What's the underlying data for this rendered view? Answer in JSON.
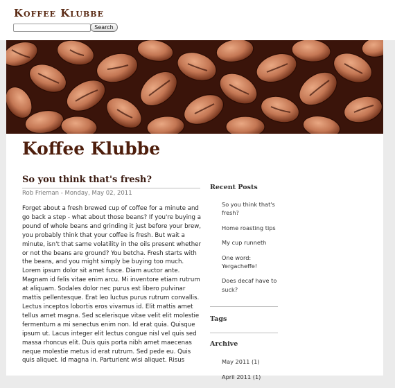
{
  "site": {
    "name": "Koffee Klubbe",
    "search_button": "Search",
    "search_value": ""
  },
  "blog": {
    "title": "Koffee Klubbe"
  },
  "post": {
    "title": "So you think that's fresh?",
    "meta": "Rob Frieman - Monday, May 02, 2011",
    "body": "Forget about a fresh brewed cup of coffee for a minute and go back a step - what about those beans? If you're buying a pound of whole beans and grinding it just before your brew, you probably think that your coffee is fresh. But wait a minute, isn't that same volatility in the oils present whether or not the beans are ground? You betcha. Fresh starts with the beans, and you might simply be buying too much. Lorem ipsum dolor sit amet fusce. Diam auctor ante. Magnam id felis vitae enim arcu. Mi inventore etiam rutrum at aliquam. Sodales dolor nec purus est libero pulvinar mattis pellentesque. Erat leo luctus purus rutrum convallis. Lectus inceptos lobortis eros vivamus id. Elit mattis amet tellus amet magna. Sed scelerisque vitae velit elit molestie fermentum a mi senectus enim non. Id erat quia. Quisque ipsum ut. Lacus integer elit lectus congue nisl vel quis sed massa rhoncus elit. Duis quis porta nibh amet maecenas neque molestie metus id erat rutrum. Sed pede eu. Quis quis aliquet. Id magna in. Parturient wisi aliquet. Risus"
  },
  "sidebar": {
    "recent_heading": "Recent Posts",
    "recent_posts": [
      "So you think that's fresh?",
      "Home roasting tips",
      "My cup runneth",
      "One word: Yergacheffe!",
      "Does decaf have to suck?"
    ],
    "tags_heading": "Tags",
    "archive_heading": "Archive",
    "archive": [
      "May 2011 (1)",
      "April 2011 (1)"
    ]
  },
  "colors": {
    "title_brown": "#4e1e0c",
    "page_bg": "#ebebeb",
    "beans_dark": "#3a140a",
    "beans_light": "#c7805d"
  }
}
